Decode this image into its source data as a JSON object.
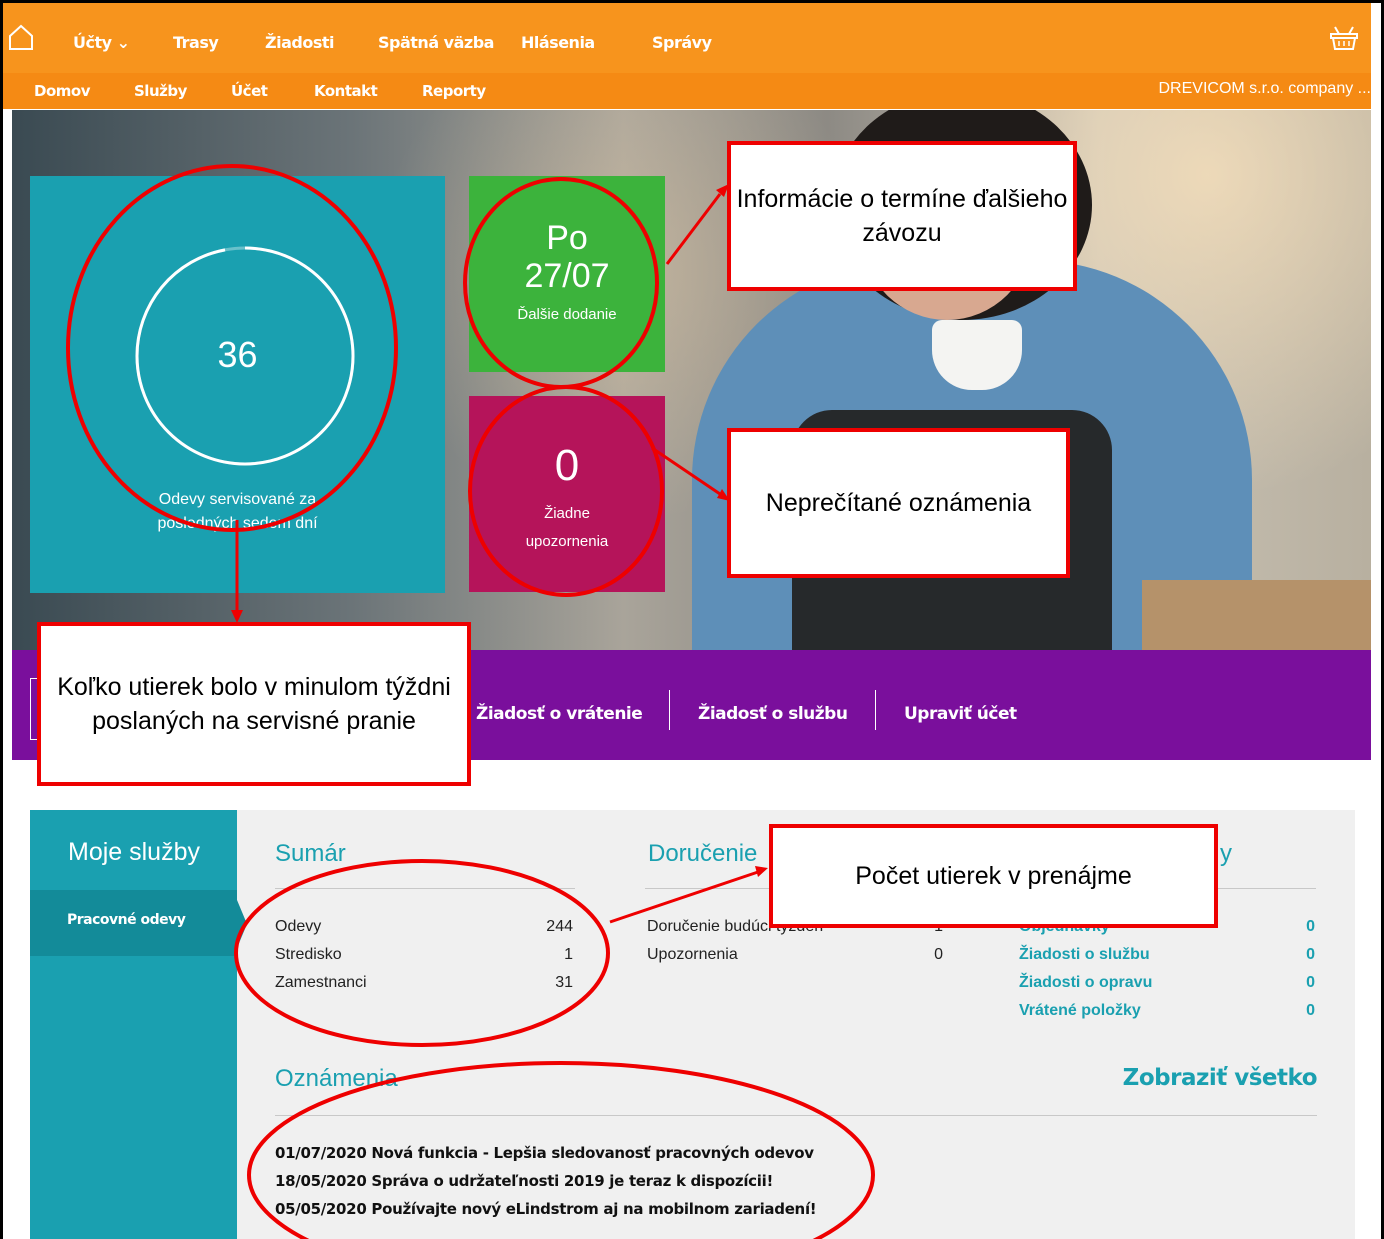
{
  "nav_top": {
    "items": [
      "Účty ⌄",
      "Trasy",
      "Žiadosti",
      "Spätná väzba",
      "Hlásenia",
      "Správy"
    ]
  },
  "nav_second": {
    "items": [
      "Domov",
      "Služby",
      "Účet",
      "Kontakt",
      "Reporty"
    ],
    "company": "DREVICOM s.r.o. company ..."
  },
  "hero": {
    "garments_count": "36",
    "garments_progress": 0.97,
    "garments_caption": "Odevy servisované za posledných sedem dní",
    "delivery_day": "Po",
    "delivery_date": "27/07",
    "delivery_label": "Ďalšie dodanie",
    "alerts_count": "0",
    "alerts_label": "Žiadne upozornenia"
  },
  "actions": [
    "Žiadosť o vrátenie",
    "Žiadosť o službu",
    "Upraviť účet"
  ],
  "services": {
    "title": "Moje služby",
    "tab": "Pracovné odevy",
    "summary": {
      "heading": "Sumár",
      "rows": [
        {
          "label": "Odevy",
          "value": "244"
        },
        {
          "label": "Stredisko",
          "value": "1"
        },
        {
          "label": "Zamestnanci",
          "value": "31"
        }
      ]
    },
    "delivery": {
      "heading": "Doručenie",
      "rows": [
        {
          "label": "Doručenie budúci týždeň",
          "value": "1"
        },
        {
          "label": "Upozornenia",
          "value": "0"
        }
      ]
    },
    "requests": {
      "heading_tail": "y",
      "rows": [
        {
          "label": "Objednávky",
          "value": "0"
        },
        {
          "label": "Žiadosti o službu",
          "value": "0"
        },
        {
          "label": "Žiadosti o opravu",
          "value": "0"
        },
        {
          "label": "Vrátené položky",
          "value": "0"
        }
      ]
    },
    "announcements": {
      "heading": "Oznámenia",
      "show_all": "Zobraziť všetko",
      "items": [
        "01/07/2020 Nová funkcia - Lepšia sledovanosť pracovných odevov",
        "18/05/2020 Správa o udržateľnosti 2019 je teraz k dispozícii!",
        "05/05/2020 Používajte nový eLindstrom aj na mobilnom zariadení!"
      ]
    }
  },
  "callouts": {
    "delivery_info": "Informácie o termíne ďalšieho závozu",
    "unread": "Neprečítané oznámenia",
    "towels_week": "Koľko utierek bolo v minulom týždni poslaných na servisné pranie",
    "towels_rent": "Počet utierek v prenájme"
  },
  "colors": {
    "orange": "#f7941d",
    "teal": "#1aa0b0",
    "green": "#3cb33c",
    "magenta": "#b5145a",
    "purple": "#7a0f9c",
    "annotation_red": "#e00000"
  }
}
